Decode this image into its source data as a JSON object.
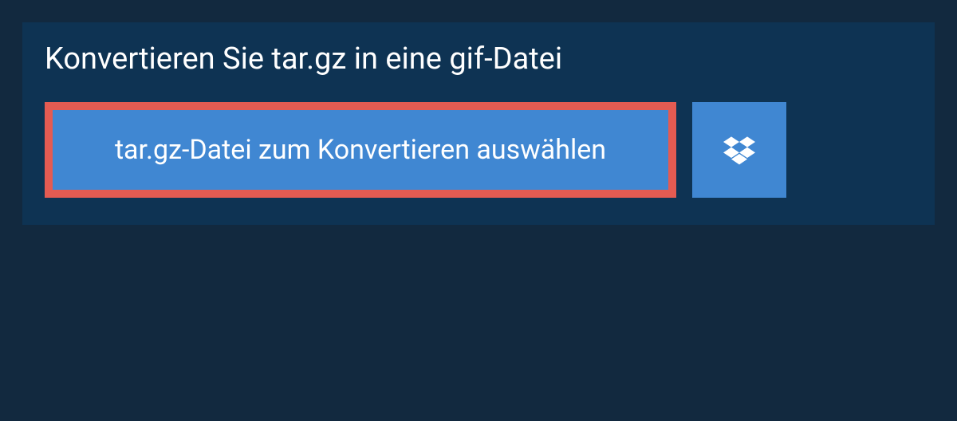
{
  "panel": {
    "title": "Konvertieren Sie tar.gz in eine gif-Datei",
    "selectFileButtonLabel": "tar.gz-Datei zum Konvertieren auswählen"
  },
  "colors": {
    "pageBackground": "#12293f",
    "panelBackground": "#0e3353",
    "buttonBackground": "#4087d2",
    "highlightBorder": "#e45b52",
    "textColor": "#ffffff"
  }
}
